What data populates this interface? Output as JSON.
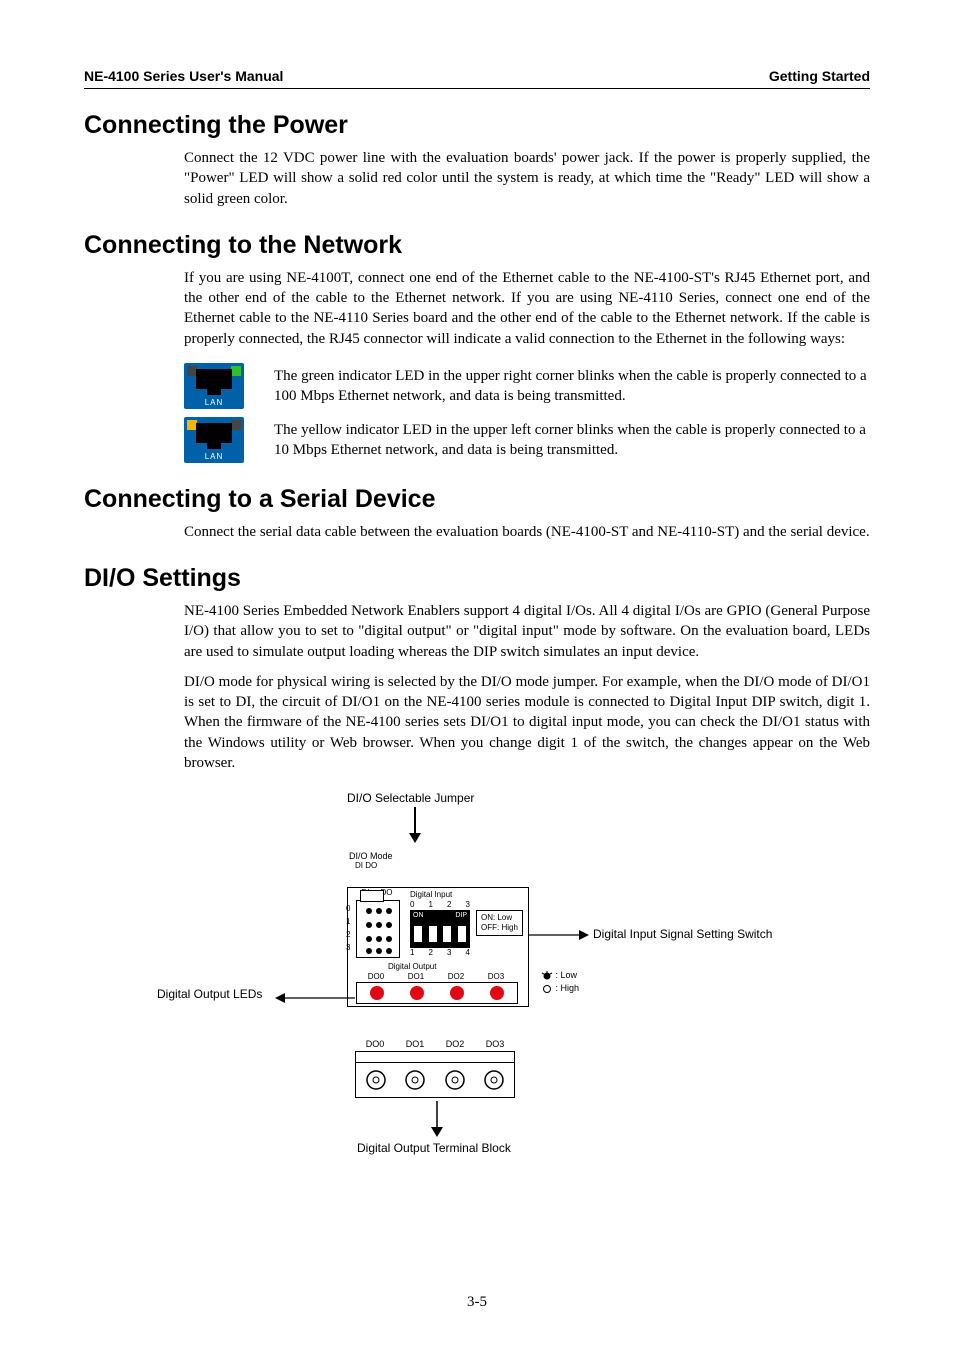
{
  "header": {
    "left": "NE-4100 Series User's Manual",
    "right": "Getting Started"
  },
  "s1": {
    "title": "Connecting the Power",
    "p1": "Connect the 12 VDC power line with the evaluation boards' power jack. If the power is properly supplied, the \"Power\" LED will show a solid red color until the system is ready, at which time the \"Ready\" LED will show a solid green color."
  },
  "s2": {
    "title": "Connecting to the Network",
    "p1": "If you are using NE-4100T, connect one end of the Ethernet cable to the NE-4100-ST's RJ45 Ethernet port, and the other end of the cable to the Ethernet network. If you are using NE-4110 Series, connect one end of the Ethernet cable to the NE-4110 Series board and the other end of the cable to the Ethernet network. If the cable is properly connected, the RJ45 connector will indicate a valid connection to the Ethernet in the following ways:",
    "led_green": "The green indicator LED in the upper right corner blinks when the cable is properly connected to a 100 Mbps Ethernet network, and data is being transmitted.",
    "led_yellow": "The yellow indicator LED in the upper left corner blinks when the cable is properly connected to a 10 Mbps Ethernet network, and data is being transmitted.",
    "lan_label": "LAN"
  },
  "s3": {
    "title": "Connecting to a Serial Device",
    "p1": "Connect the serial data cable between the evaluation boards (NE-4100-ST and NE-4110-ST) and the serial device."
  },
  "s4": {
    "title": "DI/O Settings",
    "p1": "NE-4100 Series Embedded Network Enablers support 4 digital I/Os. All 4 digital I/Os are GPIO (General Purpose I/O) that allow you to set to \"digital output\" or \"digital input\" mode by software. On the evaluation board, LEDs are used to simulate output loading whereas the DIP switch simulates an input device.",
    "p2": "DI/O mode for physical wiring is selected by the DI/O mode jumper. For example, when the DI/O mode of DI/O1 is set to DI, the circuit of DI/O1 on the NE-4100 series module is connected to Digital Input DIP switch, digit 1. When the firmware of the NE-4100 series sets DI/O1 to digital input mode, you can check the DI/O1 status with the Windows utility or Web browser. When you change digit 1 of the switch, the changes appear on the Web browser."
  },
  "diagram": {
    "jumper_label": "DI/O Selectable Jumper",
    "mode_label": "DI/O Mode",
    "di": "DI",
    "do": "DO",
    "digital_input_label": "Digital Input",
    "digital_output_label": "Digital Output",
    "on_label": "ON",
    "dip_label": "DIP",
    "on_low": "ON: Low",
    "off_high": "OFF: High",
    "out_leds_label": "Digital Output LEDs",
    "in_switch_label": "Digital Input Signal Setting Switch",
    "terminal_label": "Digital Output Terminal Block",
    "legend_low": ": Low",
    "legend_high": ": High",
    "rows": [
      "0",
      "1",
      "2",
      "3"
    ],
    "dip_nums_top": [
      "0",
      "1",
      "2",
      "3"
    ],
    "dip_nums_bottom": [
      "1",
      "2",
      "3",
      "4"
    ],
    "do_cols": [
      "DO0",
      "DO1",
      "DO2",
      "DO3"
    ]
  },
  "page_number": "3-5"
}
